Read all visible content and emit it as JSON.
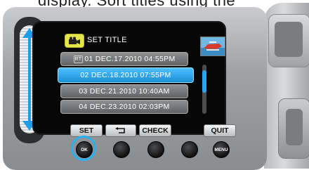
{
  "top_caption": "display. Sort titles using the",
  "header": {
    "title": "SET TITLE",
    "title_icon": "video-camera-icon"
  },
  "list": [
    {
      "tag": "RT",
      "label": "01 DEC.17.2010 04:55PM",
      "selected": false
    },
    {
      "tag": "",
      "label": "02 DEC.18.2010 07:55PM",
      "selected": true
    },
    {
      "tag": "",
      "label": "03 DEC.21.2010 10:40AM",
      "selected": false
    },
    {
      "tag": "",
      "label": "04 DEC.23.2010 02:03PM",
      "selected": false
    }
  ],
  "soft_buttons": {
    "set": "SET",
    "back_icon": "return-arrow-icon",
    "check": "CHECK",
    "quit": "QUIT"
  },
  "hardware_buttons": {
    "ok": "OK",
    "menu": "MENU"
  },
  "colors": {
    "selection": "#2aa6f0",
    "title_icon_bg": "#e6e64a",
    "screen_bg": "#070707"
  }
}
